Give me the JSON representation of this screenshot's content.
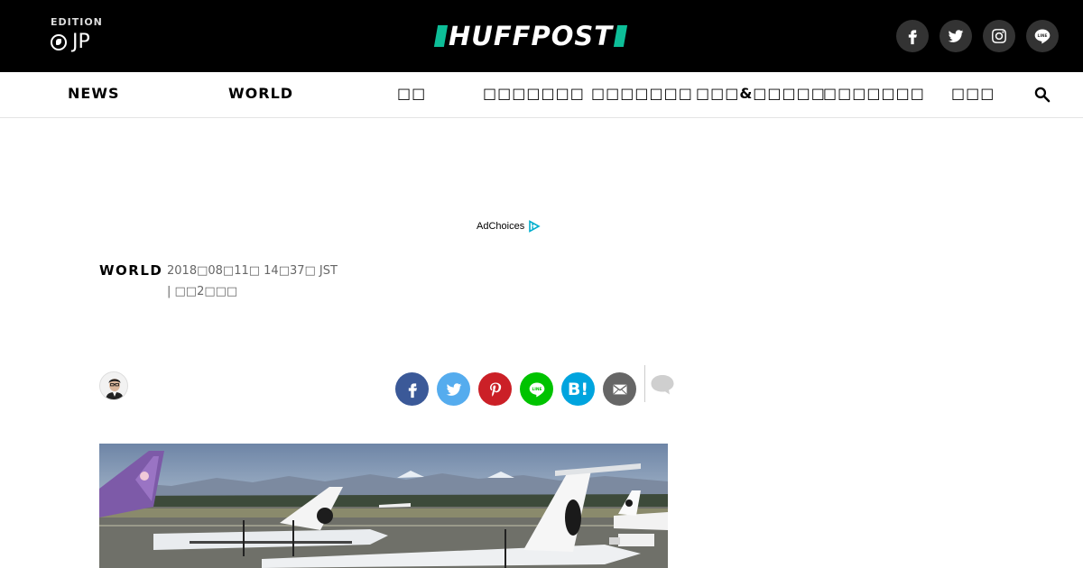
{
  "header": {
    "edition_label": "EDITION",
    "edition_code": "JP",
    "logo_text": "HUFFPOST",
    "brand_color": "#0dbe98",
    "social": [
      {
        "name": "facebook-icon"
      },
      {
        "name": "twitter-icon"
      },
      {
        "name": "instagram-icon"
      },
      {
        "name": "line-icon",
        "text": "LINE"
      }
    ]
  },
  "nav": {
    "items": [
      {
        "label": "NEWS"
      },
      {
        "label": "WORLD"
      },
      {
        "label": "□□"
      },
      {
        "label": "□□□□□□□"
      },
      {
        "label": "□□□□□□□"
      },
      {
        "label": "□□□&□□□□□"
      },
      {
        "label": "□□□□□□□"
      },
      {
        "label": "□□□"
      }
    ],
    "search_icon": "search-icon"
  },
  "ad": {
    "adchoices_label": "AdChoices"
  },
  "article": {
    "section": "WORLD",
    "timestamp": "2018□08□11□ 14□37□ JST",
    "updated": "| □□2□□□"
  },
  "share": {
    "buttons": [
      {
        "name": "facebook",
        "color": "#3b5998"
      },
      {
        "name": "twitter",
        "color": "#55acee"
      },
      {
        "name": "pinterest",
        "color": "#cb2027"
      },
      {
        "name": "line",
        "color": "#00c300",
        "text": "LINE"
      },
      {
        "name": "hatena",
        "color": "#00a4de",
        "text": "B!"
      },
      {
        "name": "email",
        "color": "#666666"
      }
    ]
  }
}
